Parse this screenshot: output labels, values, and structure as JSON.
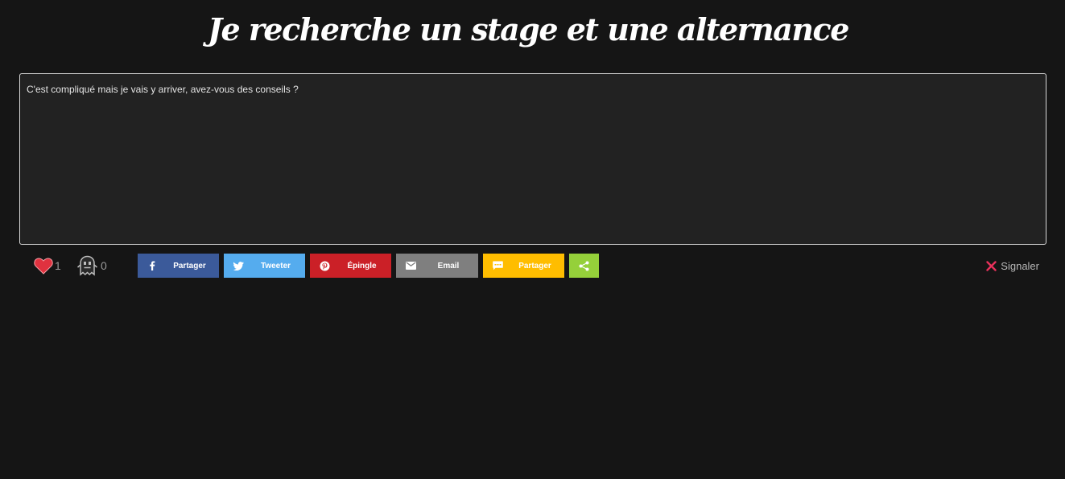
{
  "post": {
    "title": "Je recherche un stage et une alternance",
    "body": "C'est compliqué mais je vais y arriver, avez-vous des conseils ?"
  },
  "reactions": {
    "likes": "1",
    "ghost_count": "0"
  },
  "share_buttons": [
    {
      "label": "Partager",
      "icon": "facebook-icon",
      "color": "#3b5a9a"
    },
    {
      "label": "Tweeter",
      "icon": "twitter-icon",
      "color": "#55acee"
    },
    {
      "label": "Épingle",
      "icon": "pinterest-icon",
      "color": "#cb2027"
    },
    {
      "label": "Email",
      "icon": "mail-icon",
      "color": "#7f7f7f"
    },
    {
      "label": "Partager",
      "icon": "sms-icon",
      "color": "#ffbd00"
    },
    {
      "label": "",
      "icon": "share-icon",
      "color": "#95d03a"
    }
  ],
  "report": {
    "label": "Signaler",
    "icon": "close-icon",
    "color": "#e8315b"
  }
}
